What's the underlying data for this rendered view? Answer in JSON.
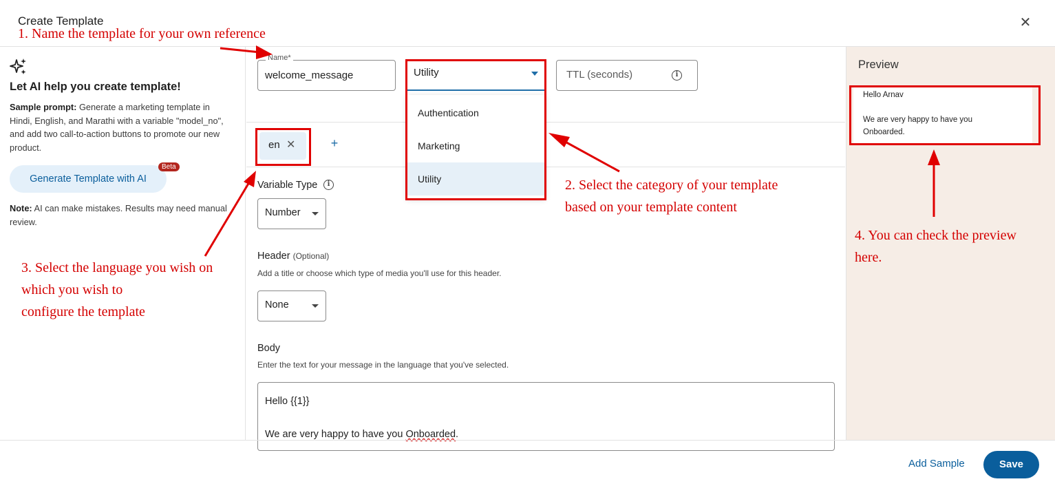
{
  "dialog": {
    "title": "Create Template",
    "close_glyph": "✕"
  },
  "ai_panel": {
    "title": "Let AI help you create template!",
    "sample_label": "Sample prompt:",
    "sample_text": " Generate a marketing template in Hindi, English, and Marathi with a variable \"model_no\", and add two call-to-action buttons to promote our new product.",
    "generate_button": "Generate Template with AI",
    "beta_badge": "Beta",
    "note_label": "Note:",
    "note_text": " AI can make mistakes. Results may need manual review."
  },
  "form": {
    "name_label": "Name*",
    "name_value": "welcome_message",
    "category_value": "Utility",
    "ttl_placeholder": "TTL (seconds)",
    "language_chip": "en",
    "language_remove_glyph": "✕",
    "add_language_glyph": "+",
    "variable_type_label": "Variable Type",
    "variable_type_value": "Number",
    "header_label": "Header",
    "header_optional": "(Optional)",
    "header_help": "Add a title or choose which type of media you'll use for this header.",
    "header_value": "None",
    "body_label": "Body",
    "body_help": "Enter the text for your message in the language that you've selected.",
    "body_line1": "Hello {{1}}",
    "body_line2_pre": "We are very happy to have you ",
    "body_line2_word": "Onboarded",
    "body_line2_post": "."
  },
  "category_menu": {
    "options": [
      "Authentication",
      "Marketing",
      "Utility"
    ],
    "selected": "Utility"
  },
  "preview": {
    "title": "Preview",
    "line1": "Hello Arnav",
    "line2": "We are very happy to have you",
    "line3": "Onboarded."
  },
  "footer": {
    "add_sample": "Add Sample",
    "save": "Save"
  },
  "annotations": {
    "step1": "1. Name the template for your own reference",
    "step2": "2. Select the category of your template\nbased on your template content",
    "step3": "3. Select the language you wish on\nwhich you wish to\nconfigure the template",
    "step4": "4. You can check the preview\nhere.",
    "color": "#e00000"
  },
  "colors": {
    "accent": "#0a5e9c",
    "preview_bg": "#f6ede6",
    "chip_bg": "#e6f0f8"
  }
}
